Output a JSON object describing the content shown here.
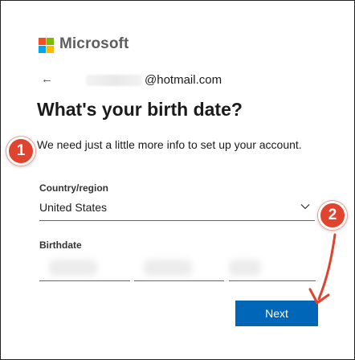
{
  "brand": {
    "name": "Microsoft",
    "logo_colors": {
      "red": "#f25022",
      "green": "#7fba00",
      "blue": "#00a4ef",
      "yellow": "#ffb900"
    }
  },
  "nav": {
    "back_icon": "←",
    "email_suffix": "@hotmail.com"
  },
  "page": {
    "title": "What's your birth date?",
    "intro": "We need just a little more info to set up your account."
  },
  "form": {
    "country_label": "Country/region",
    "country_value": "United States",
    "birthdate_label": "Birthdate",
    "next_label": "Next"
  },
  "annotations": {
    "marker_1": "1",
    "marker_2": "2",
    "color": "#e0442f"
  },
  "colors": {
    "primary_button": "#0067b8"
  }
}
